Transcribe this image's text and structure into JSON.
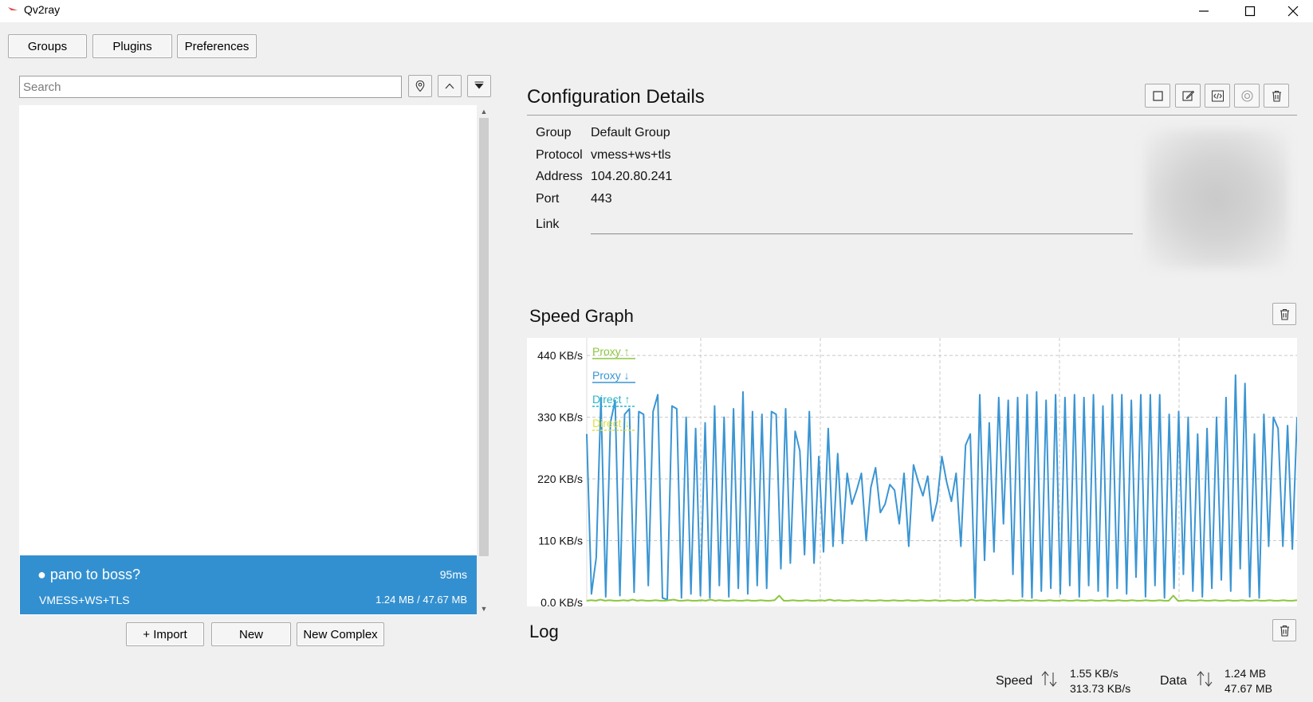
{
  "window": {
    "title": "Qv2ray"
  },
  "toolbar": {
    "groups_label": "Groups",
    "plugins_label": "Plugins",
    "preferences_label": "Preferences"
  },
  "search": {
    "placeholder": "Search",
    "value": ""
  },
  "connection": {
    "name": "● pano to boss?",
    "latency": "95ms",
    "protocol": "VMESS+WS+TLS",
    "data": "1.24 MB / 47.67 MB"
  },
  "bottom_buttons": {
    "import_label": "+ Import",
    "new_label": "New",
    "new_complex_label": "New Complex"
  },
  "details": {
    "title": "Configuration Details",
    "group_label": "Group",
    "group_value": "Default Group",
    "protocol_label": "Protocol",
    "protocol_value": "vmess+ws+tls",
    "address_label": "Address",
    "address_value": "104.20.80.241",
    "port_label": "Port",
    "port_value": "443",
    "link_label": "Link",
    "link_value": ""
  },
  "speed_graph": {
    "title": "Speed Graph"
  },
  "log": {
    "title": "Log"
  },
  "status": {
    "speed_label": "Speed",
    "speed_up": "1.55 KB/s",
    "speed_down": "313.73 KB/s",
    "data_label": "Data",
    "data_up": "1.24 MB",
    "data_down": "47.67 MB"
  },
  "chart_data": {
    "type": "line",
    "y_ticks": [
      "440 KB/s",
      "330 KB/s",
      "220 KB/s",
      "110 KB/s",
      "0.0 KB/s"
    ],
    "ylim": [
      0,
      460
    ],
    "legend": [
      "Proxy ↑",
      "Proxy ↓",
      "Direct ↑",
      "Direct ↓"
    ],
    "legend_placement": "top-left",
    "grid": true,
    "series": [
      {
        "name": "Proxy ↓",
        "color": "#3a95d3",
        "values": [
          300,
          15,
          80,
          365,
          10,
          320,
          360,
          12,
          335,
          345,
          18,
          340,
          335,
          30,
          340,
          370,
          8,
          5,
          350,
          345,
          8,
          330,
          15,
          310,
          12,
          320,
          8,
          350,
          30,
          330,
          10,
          345,
          25,
          375,
          15,
          340,
          30,
          335,
          25,
          340,
          335,
          60,
          345,
          70,
          305,
          270,
          85,
          340,
          70,
          260,
          90,
          310,
          100,
          265,
          105,
          230,
          175,
          200,
          230,
          110,
          205,
          240,
          160,
          175,
          210,
          200,
          140,
          230,
          100,
          245,
          215,
          190,
          225,
          145,
          180,
          260,
          215,
          180,
          230,
          100,
          280,
          300,
          8,
          370,
          75,
          320,
          90,
          365,
          140,
          360,
          50,
          365,
          10,
          370,
          8,
          375,
          20,
          360,
          25,
          370,
          15,
          365,
          30,
          370,
          10,
          365,
          30,
          370,
          20,
          350,
          10,
          370,
          25,
          370,
          15,
          360,
          45,
          370,
          10,
          370,
          30,
          370,
          8,
          335,
          25,
          340,
          50,
          330,
          20,
          300,
          10,
          310,
          25,
          330,
          40,
          365,
          20,
          405,
          60,
          390,
          10,
          300,
          8,
          335,
          100,
          330,
          310,
          100,
          315,
          95,
          330
        ]
      },
      {
        "name": "Proxy ↑",
        "color": "#8dc63f",
        "values": [
          3,
          4,
          3,
          5,
          3,
          4,
          3,
          3,
          4,
          3,
          5,
          3,
          4,
          3,
          3,
          4,
          3,
          3,
          4,
          5,
          3,
          3,
          4,
          3,
          3,
          4,
          3,
          5,
          3,
          4,
          3,
          3,
          4,
          3,
          3,
          4,
          3,
          3,
          4,
          3,
          3,
          4,
          12,
          3,
          3,
          4,
          3,
          3,
          4,
          3,
          3,
          4,
          3,
          5,
          3,
          4,
          3,
          3,
          4,
          3,
          3,
          4,
          3,
          3,
          4,
          3,
          3,
          4,
          3,
          3,
          4,
          3,
          3,
          4,
          3,
          3,
          4,
          3,
          3,
          4,
          3,
          3,
          4,
          3,
          5,
          3,
          4,
          3,
          3,
          4,
          3,
          3,
          4,
          3,
          3,
          4,
          3,
          3,
          4,
          3,
          3,
          4,
          3,
          3,
          4,
          3,
          3,
          4,
          3,
          3,
          4,
          3,
          3,
          4,
          3,
          3,
          4,
          3,
          3,
          4,
          3,
          3,
          4,
          3,
          3,
          4,
          3,
          3,
          12,
          3,
          3,
          4,
          3,
          3,
          4,
          3,
          3,
          4,
          3,
          3,
          4,
          3,
          3,
          4,
          3,
          3,
          4,
          3,
          3,
          4,
          3,
          3,
          4,
          3,
          3,
          4
        ]
      }
    ]
  }
}
